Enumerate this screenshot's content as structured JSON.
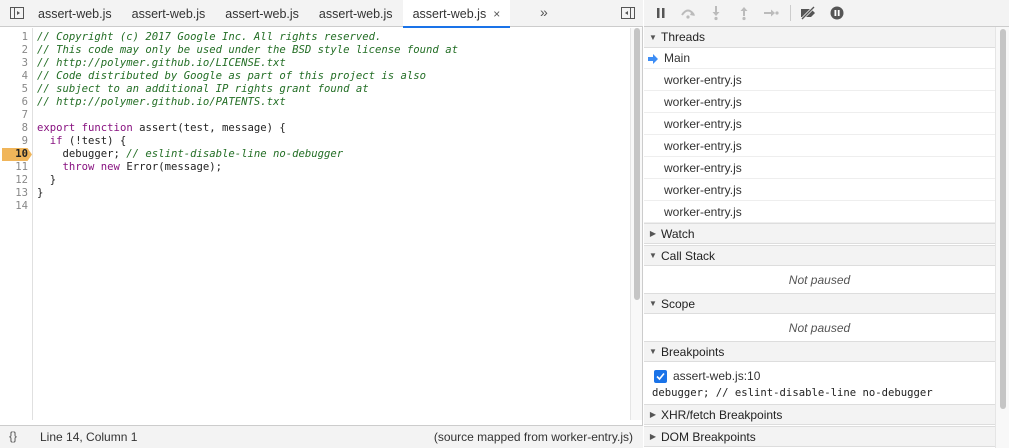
{
  "editor": {
    "tabs": [
      {
        "label": "assert-web.js"
      },
      {
        "label": "assert-web.js"
      },
      {
        "label": "assert-web.js"
      },
      {
        "label": "assert-web.js"
      },
      {
        "label": "assert-web.js",
        "active": true,
        "close": "×"
      }
    ],
    "more_tabs": "»",
    "lines": [
      {
        "n": "1",
        "text": "// Copyright (c) 2017 Google Inc. All rights reserved."
      },
      {
        "n": "2",
        "text": "// This code may only be used under the BSD style license found at"
      },
      {
        "n": "3",
        "text": "// http://polymer.github.io/LICENSE.txt"
      },
      {
        "n": "4",
        "text": "// Code distributed by Google as part of this project is also"
      },
      {
        "n": "5",
        "text": "// subject to an additional IP rights grant found at"
      },
      {
        "n": "6",
        "text": "// http://polymer.github.io/PATENTS.txt"
      },
      {
        "n": "7",
        "text": ""
      },
      {
        "n": "8",
        "text": "export function assert(test, message) {"
      },
      {
        "n": "9",
        "text": "  if (!test) {"
      },
      {
        "n": "10",
        "text": "    debugger; // eslint-disable-line no-debugger"
      },
      {
        "n": "11",
        "text": "    throw new Error(message);"
      },
      {
        "n": "12",
        "text": "  }"
      },
      {
        "n": "13",
        "text": "}"
      },
      {
        "n": "14",
        "text": ""
      }
    ],
    "breakpoint_line": "10"
  },
  "status": {
    "pretty_print": "{}",
    "cursor": "Line 14, Column 1",
    "source_map": "(source mapped from worker-entry.js)"
  },
  "sidebar": {
    "threads": {
      "title": "Threads",
      "items": [
        "Main",
        "worker-entry.js",
        "worker-entry.js",
        "worker-entry.js",
        "worker-entry.js",
        "worker-entry.js",
        "worker-entry.js",
        "worker-entry.js"
      ]
    },
    "watch": {
      "title": "Watch"
    },
    "call_stack": {
      "title": "Call Stack",
      "empty": "Not paused"
    },
    "scope": {
      "title": "Scope",
      "empty": "Not paused"
    },
    "breakpoints": {
      "title": "Breakpoints",
      "item_label": "assert-web.js:10",
      "item_code": "debugger; // eslint-disable-line no-debugger"
    },
    "xhr": {
      "title": "XHR/fetch Breakpoints"
    },
    "dom": {
      "title": "DOM Breakpoints"
    }
  },
  "colors": {
    "accent": "#1a73e8",
    "breakpoint": "#f0b55a",
    "comment": "#236e25",
    "keyword": "#881280"
  }
}
